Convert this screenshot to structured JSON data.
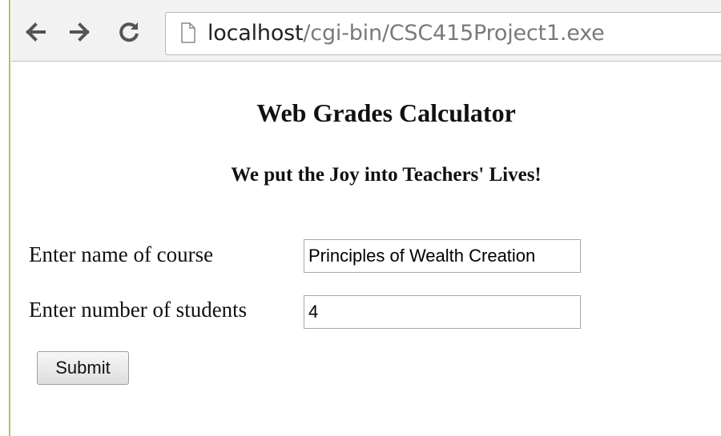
{
  "browser": {
    "back_icon": "back-arrow-icon",
    "forward_icon": "forward-arrow-icon",
    "reload_icon": "reload-icon",
    "page_icon": "document-page-icon",
    "url_host": "localhost",
    "url_path": "/cgi-bin/CSC415Project1.exe"
  },
  "page": {
    "title": "Web Grades Calculator",
    "subtitle": "We put the Joy into Teachers' Lives!",
    "form": {
      "course_label": "Enter name of course",
      "course_value": "Principles of Wealth Creation",
      "students_label": "Enter number of students",
      "students_value": "4",
      "submit_label": "Submit"
    }
  },
  "colors": {
    "toolbar_background": "#f2f2f2",
    "window_accent": "#b8c24a"
  }
}
